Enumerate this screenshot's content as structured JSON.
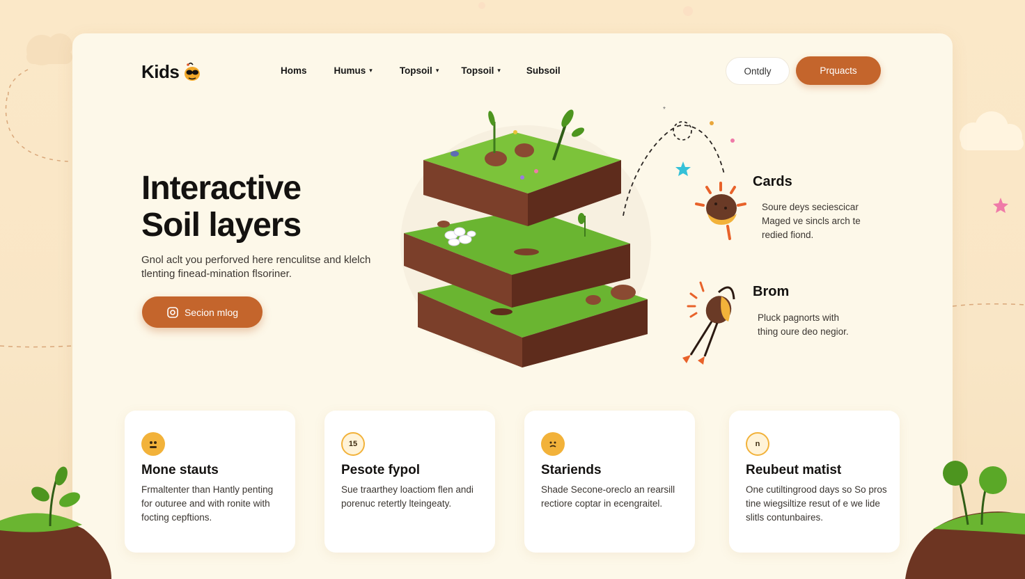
{
  "header": {
    "logo_text": "Kids",
    "nav": [
      {
        "label": "Homs",
        "has_dropdown": false
      },
      {
        "label": "Humus",
        "has_dropdown": true
      },
      {
        "label": "Topsoil",
        "has_dropdown": true
      },
      {
        "label": "Topsoil",
        "has_dropdown": true
      },
      {
        "label": "Subsoil",
        "has_dropdown": false
      }
    ],
    "outline_button": "Ontdly",
    "primary_button": "Prquacts"
  },
  "hero": {
    "title_line1": "Interactive",
    "title_line2": "Soil layers",
    "description": "Gnol aclt you perforved here renculitse and klelch tlenting finead-mination flsoriner.",
    "cta_label": "Secion mlog"
  },
  "side_cards": [
    {
      "title": "Cards",
      "text_lines": [
        "Soure deys seciescicar",
        "Maged ve sincls arch te",
        "redied fiond."
      ]
    },
    {
      "title": "Brom",
      "text_lines": [
        "Pluck pagnorts with",
        "thing oure deo negior."
      ]
    }
  ],
  "features": [
    {
      "icon": "face-icon",
      "icon_text": "",
      "title": "Mone stauts",
      "text": "Frmaltenter than Hantly penting for outuree and with ronite with focting cepftions."
    },
    {
      "icon": "number-icon",
      "icon_text": "15",
      "title": "Pesote fypol",
      "text": "Sue traarthey loactiom flen andi porenuc retertly lteingeaty."
    },
    {
      "icon": "smiley-icon",
      "icon_text": "",
      "title": "Stariends",
      "text": "Shade Secone-oreclo an rearsill rectiore coptar in ecengraitel."
    },
    {
      "icon": "letter-icon",
      "icon_text": "n",
      "title": "Reubeut matist",
      "text": "One cutiltingrood days so So pros tine wiegsiltize resut of e we lide slitls contunbaires."
    }
  ],
  "colors": {
    "accent": "#c4652c",
    "icon_yellow": "#f2b23a",
    "grass": "#6ab531",
    "soil": "#7b3f2a",
    "page_bg": "#fbe8c8",
    "panel_bg": "#fdf8e9"
  }
}
